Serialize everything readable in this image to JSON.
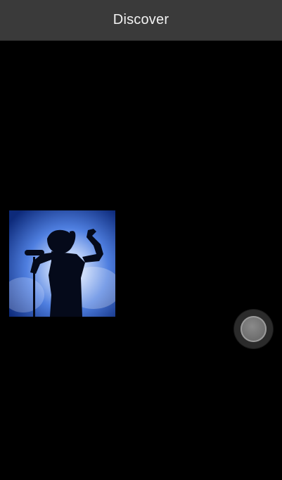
{
  "app_bar": {
    "title": "Discover"
  },
  "media": {
    "thumbnail_icon": "singer-silhouette-photo"
  },
  "fab": {
    "icon": "record-circle-icon"
  },
  "colors": {
    "app_bar_bg": "#3a3a3a",
    "background": "#000000",
    "accent_blue": "#3a6fd8"
  }
}
